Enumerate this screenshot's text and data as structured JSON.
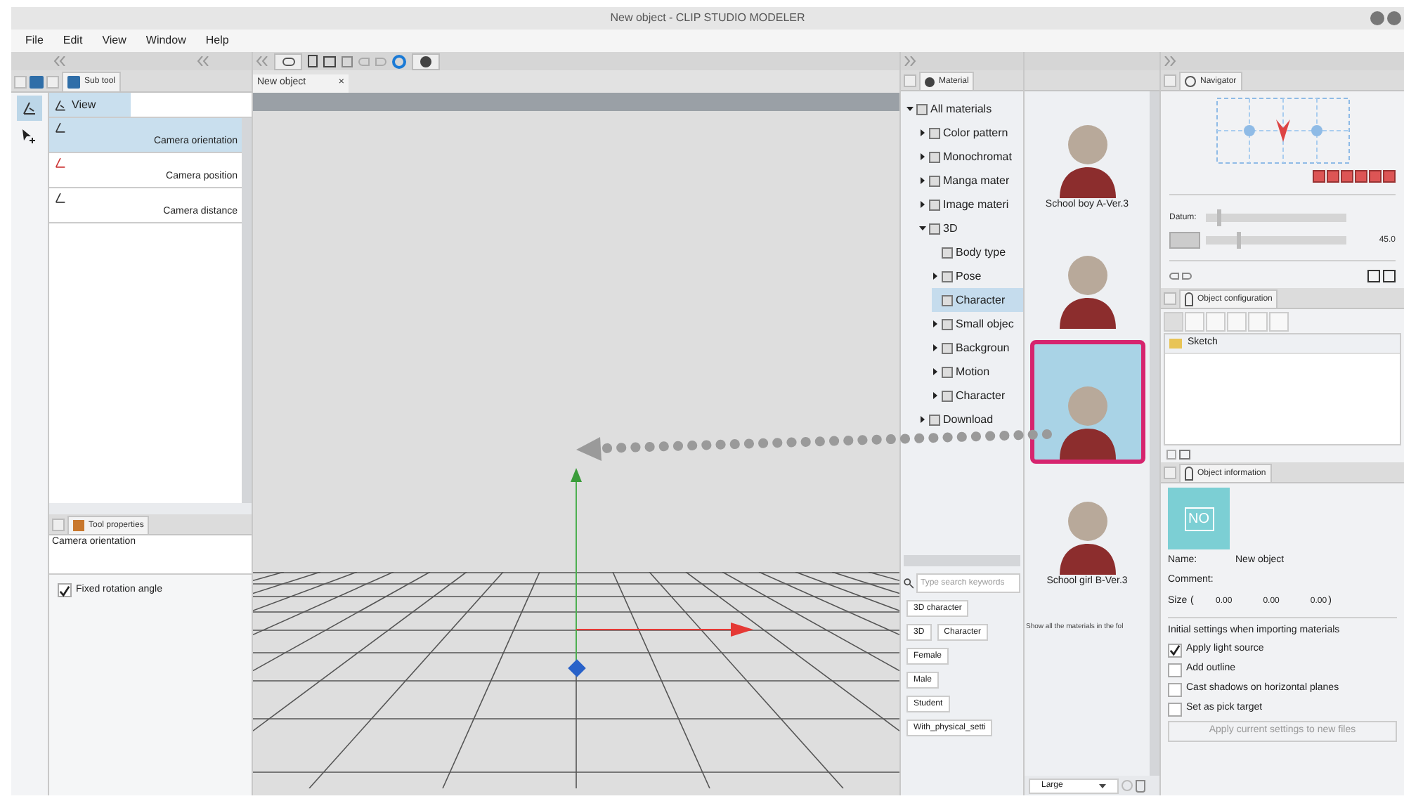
{
  "window": {
    "title": "New object - CLIP STUDIO MODELER"
  },
  "menu": [
    "File",
    "Edit",
    "View",
    "Window",
    "Help"
  ],
  "tools": [
    {
      "kind": "camera",
      "selected": true
    },
    {
      "kind": "pointer",
      "selected": false
    }
  ],
  "sub_tool": {
    "tab": "Sub tool",
    "group": "View",
    "items": [
      {
        "label": "Camera orientation",
        "selected": true
      },
      {
        "label": "Camera position",
        "selected": false
      },
      {
        "label": "Camera distance",
        "selected": false
      }
    ]
  },
  "tool_properties": {
    "tab": "Tool properties",
    "title": "Camera orientation",
    "options": [
      {
        "label": "Fixed rotation angle",
        "checked": true
      }
    ]
  },
  "document_tab": {
    "label": "New object",
    "close": "×"
  },
  "material": {
    "tab": "Material",
    "tree": [
      {
        "label": "All materials",
        "kind": "folder",
        "expanded": true,
        "selected": false,
        "children": [
          {
            "label": "Color pattern",
            "kind": "folder",
            "expanded": false,
            "selected": false
          },
          {
            "label": "Monochromat",
            "kind": "folder",
            "expanded": false,
            "selected": false
          },
          {
            "label": "Manga mater",
            "kind": "folder",
            "expanded": false,
            "selected": false
          },
          {
            "label": "Image materi",
            "kind": "folder",
            "expanded": false,
            "selected": false
          },
          {
            "label": "3D",
            "kind": "folder",
            "expanded": true,
            "selected": false,
            "children": [
              {
                "label": "Body type",
                "kind": "leaf",
                "selected": false
              },
              {
                "label": "Pose",
                "kind": "folder",
                "expanded": false,
                "selected": false
              },
              {
                "label": "Character",
                "kind": "leaf",
                "selected": true
              },
              {
                "label": "Small objec",
                "kind": "folder",
                "expanded": false,
                "selected": false
              },
              {
                "label": "Backgroun",
                "kind": "folder",
                "expanded": false,
                "selected": false
              },
              {
                "label": "Motion",
                "kind": "folder",
                "expanded": false,
                "selected": false
              },
              {
                "label": "Character",
                "kind": "folder",
                "expanded": false,
                "selected": false
              }
            ]
          },
          {
            "label": "Download",
            "kind": "folder",
            "expanded": false,
            "selected": false
          }
        ]
      }
    ],
    "search": {
      "placeholder": "Type search keywords"
    },
    "tag_rows": [
      {
        "tags": [
          "3D character"
        ]
      },
      {
        "tags": [
          "3D",
          "Character"
        ]
      },
      {
        "tags": [
          "Female"
        ]
      },
      {
        "tags": [
          "Male"
        ]
      },
      {
        "tags": [
          "Student"
        ]
      },
      {
        "tags": [
          "With_physical_setti"
        ]
      }
    ],
    "thumbnails": [
      {
        "label": "School boy A-Ver.3",
        "highlighted": false
      },
      {
        "highlighted": false
      },
      {
        "highlighted": true
      },
      {
        "label": "School girl B-Ver.3",
        "highlighted": false
      }
    ],
    "hint": "Show all the materials in the fol",
    "size_select": "Large"
  },
  "navigator": {
    "tab": "Navigator",
    "sliders": [
      {
        "kind": "label",
        "label": "Datum:",
        "level": 0.08
      },
      {
        "kind": "icon",
        "level": 0.22,
        "reading": "45.0"
      }
    ]
  },
  "object_configuration": {
    "tab": "Object configuration",
    "items": [
      {
        "label": "Sketch"
      }
    ]
  },
  "object_information": {
    "tab": "Object information",
    "no_image": "NO",
    "fields": [
      {
        "label": "Name:",
        "value": "New object"
      },
      {
        "label": "Comment:"
      }
    ],
    "size": {
      "label": "Size",
      "open": "(",
      "values": [
        "0.00",
        "0.00",
        "0.00"
      ],
      "close": ")"
    },
    "settings_title": "Initial settings when importing materials",
    "options": [
      {
        "label": "Apply light source",
        "checked": true
      },
      {
        "label": "Add outline",
        "checked": false
      },
      {
        "label": "Cast shadows on horizontal planes",
        "checked": false
      },
      {
        "label": "Set as pick target",
        "checked": false
      }
    ],
    "button": {
      "label": "Apply current settings to new files",
      "disabled": true
    }
  }
}
